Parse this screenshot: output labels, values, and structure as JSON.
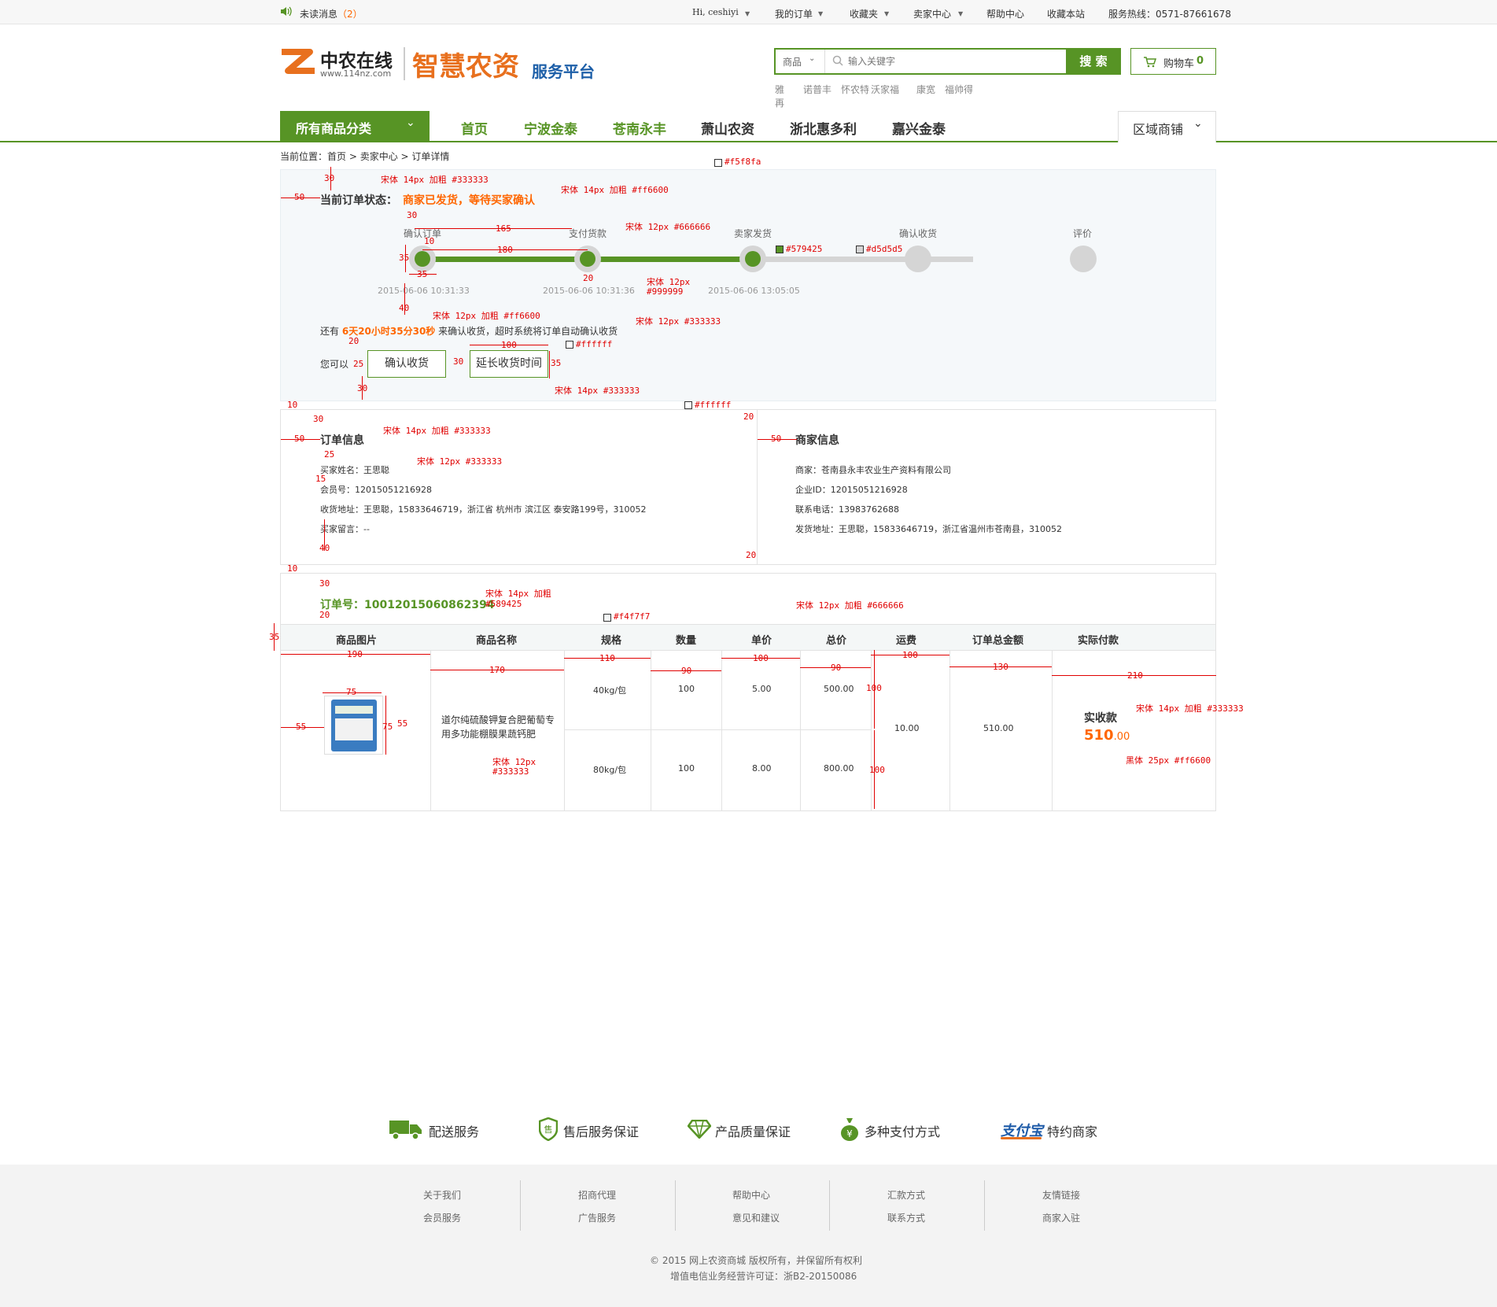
{
  "topbar": {
    "msg_label": "未读消息",
    "msg_count": "（2）",
    "greeting": "Hi, ceshiyi",
    "my_orders": "我的订单",
    "favorites": "收藏夹",
    "seller_center": "卖家中心",
    "help": "帮助中心",
    "bookmark": "收藏本站",
    "hotline": "服务热线：0571-87661678"
  },
  "header": {
    "logo_cn": "中农在线",
    "logo_url": "www.114nz.com",
    "slogan_main": "智慧农资",
    "slogan_sub": "服务平台",
    "search_scope": "商品",
    "search_placeholder": "输入关键字",
    "search_button": "搜 索",
    "cart_label": "购物车",
    "cart_count": "0",
    "hot_keywords": [
      "雅再",
      "诺普丰",
      "怀农特",
      "沃家福",
      "康宽",
      "福帅得"
    ]
  },
  "nav": {
    "all_categories": "所有商品分类",
    "links": [
      "首页",
      "宁波金泰",
      "苍南永丰",
      "萧山农资",
      "浙北惠多利",
      "嘉兴金泰"
    ],
    "region": "区域商铺"
  },
  "breadcrumb": {
    "prefix": "当前位置：",
    "items": [
      "首页",
      "卖家中心",
      "订单详情"
    ]
  },
  "status": {
    "label": "当前订单状态：",
    "value": "商家已发货，等待买家确认",
    "steps": [
      {
        "label": "确认订单",
        "time": "2015-06-06 10:31:33"
      },
      {
        "label": "支付货款",
        "time": "2015-06-06 10:31:36"
      },
      {
        "label": "卖家发货",
        "time": "2015-06-06 13:05:05"
      },
      {
        "label": "确认收货",
        "time": ""
      },
      {
        "label": "评价",
        "time": ""
      }
    ],
    "remain_prefix": "还有",
    "remain_time": "6天20小时35分30秒",
    "remain_suffix": "来确认收货，超时系统将订单自动确认收货",
    "you_can": "您可以",
    "confirm_btn": "确认收货",
    "extend_btn": "延长收货时间"
  },
  "order_info": {
    "title": "订单信息",
    "buyer_name": "买家姓名：王思聪",
    "member_no": "会员号：12015051216928",
    "address": "收货地址：王思聪，15833646719，浙江省 杭州市 滨江区 泰安路199号，310052",
    "message": "买家留言：--"
  },
  "merchant_info": {
    "title": "商家信息",
    "merchant": "商家：苍南县永丰农业生产资料有限公司",
    "company_id": "企业ID：12015051216928",
    "phone": "联系电话：13983762688",
    "ship_addr": "发货地址：王思聪，15833646719，浙江省温州市苍南县，310052"
  },
  "order": {
    "no_label": "订单号：",
    "no_value": "10012015060862394",
    "headers": [
      "商品图片",
      "商品名称",
      "规格",
      "数量",
      "单价",
      "总价",
      "运费",
      "订单总金额",
      "实际付款"
    ],
    "product_name": "道尔纯硫酸钾复合肥葡萄专用多功能棚膜果蔬钙肥",
    "rows": [
      {
        "spec": "40kg/包",
        "qty": "100",
        "price": "5.00",
        "total": "500.00"
      },
      {
        "spec": "80kg/包",
        "qty": "100",
        "price": "8.00",
        "total": "800.00"
      }
    ],
    "shipping": "10.00",
    "order_total": "510.00",
    "paid_label": "实收款",
    "paid_int": "510",
    "paid_dec": ".00"
  },
  "annotations": {
    "bg1": "#f5f8fa",
    "s14b333": "宋体 14px 加粗 #333333",
    "s14bff": "宋体 14px 加粗 #ff6600",
    "s12_666": "宋体 12px #666666",
    "c579": "#579425",
    "cd5": "#d5d5d5",
    "s12": "宋体 12px",
    "c999": "#999999",
    "s12bff": "宋体 12px 加粗 #ff6600",
    "s12_333": "宋体 12px #333333",
    "cfff": "#ffffff",
    "s14_333": "宋体 14px #333333",
    "s14b": "宋体 14px 加粗",
    "c589": "#589425",
    "cf4": "#f4f7f7",
    "s12b666": "宋体 12px 加粗 #666666",
    "c333": "#333333",
    "h25": "黑体 25px #ff6600",
    "n30": "30",
    "n50": "50",
    "n165": "165",
    "n180": "180",
    "n10": "10",
    "n35": "35",
    "n20": "20",
    "n40": "40",
    "n100": "100",
    "n25": "25",
    "n15": "15",
    "n190": "190",
    "n170": "170",
    "n110": "110",
    "n90": "90",
    "n130": "130",
    "n210": "210",
    "n75": "75",
    "n55": "55"
  },
  "services": [
    "配送服务",
    "售后服务保证",
    "产品质量保证",
    "多种支付方式",
    "特约商家"
  ],
  "alipay_text": "支付宝",
  "footer": {
    "cols": [
      [
        "关于我们",
        "会员服务"
      ],
      [
        "招商代理",
        "广告服务"
      ],
      [
        "帮助中心",
        "意见和建议"
      ],
      [
        "汇款方式",
        "联系方式"
      ],
      [
        "友情链接",
        "商家入驻"
      ]
    ],
    "copyright": "© 2015  网上农资商城  版权所有，并保留所有权利",
    "license": "增值电信业务经营许可证：浙B2-20150086"
  },
  "colors": {
    "green": "#579425",
    "orange": "#ff6600",
    "bg": "#f5f8fa",
    "gray_step": "#d5d5d5",
    "table_head": "#f4f7f7"
  }
}
